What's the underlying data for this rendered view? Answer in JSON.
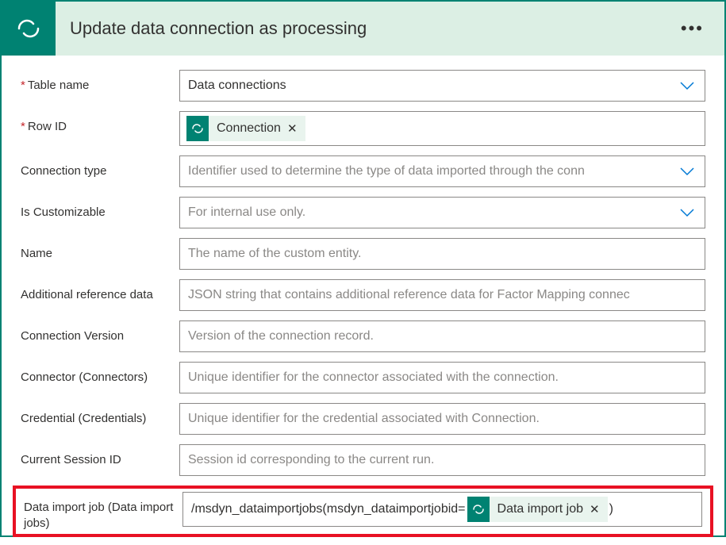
{
  "header": {
    "title": "Update data connection as processing"
  },
  "fields": {
    "table_name": {
      "label": "Table name",
      "value": "Data connections"
    },
    "row_id": {
      "label": "Row ID",
      "token": "Connection"
    },
    "connection_type": {
      "label": "Connection type",
      "placeholder": "Identifier used to determine the type of data imported through the conn"
    },
    "is_customizable": {
      "label": "Is Customizable",
      "placeholder": "For internal use only."
    },
    "name": {
      "label": "Name",
      "placeholder": "The name of the custom entity."
    },
    "additional_ref": {
      "label": "Additional reference data",
      "placeholder": "JSON string that contains additional reference data for Factor Mapping connec"
    },
    "connection_version": {
      "label": "Connection Version",
      "placeholder": "Version of the connection record."
    },
    "connector": {
      "label": "Connector (Connectors)",
      "placeholder": "Unique identifier for the connector associated with the connection."
    },
    "credential": {
      "label": "Credential (Credentials)",
      "placeholder": "Unique identifier for the credential associated with Connection."
    },
    "current_session": {
      "label": "Current Session ID",
      "placeholder": "Session id corresponding to the current run."
    },
    "data_import_job": {
      "label": "Data import job (Data import jobs)",
      "prefix": "/msdyn_dataimportjobs(msdyn_dataimportjobid=",
      "token": "Data import job",
      "suffix": ")"
    }
  }
}
